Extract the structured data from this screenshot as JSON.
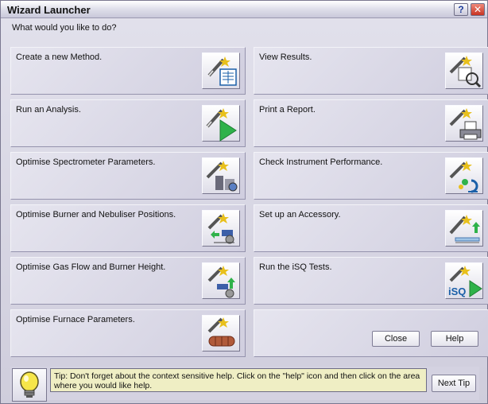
{
  "window": {
    "title": "Wizard Launcher",
    "help_glyph": "?",
    "close_glyph": "✕"
  },
  "prompt": "What would you like to do?",
  "left_cards": [
    {
      "label": "Create a new Method.",
      "icon": "method-wizard-icon"
    },
    {
      "label": "Run an Analysis.",
      "icon": "run-analysis-icon"
    },
    {
      "label": "Optimise Spectrometer Parameters.",
      "icon": "spectrometer-icon"
    },
    {
      "label": "Optimise Burner and Nebuliser Positions.",
      "icon": "burner-position-icon"
    },
    {
      "label": "Optimise Gas Flow and Burner Height.",
      "icon": "gas-flow-icon"
    },
    {
      "label": "Optimise Furnace Parameters.",
      "icon": "furnace-icon"
    }
  ],
  "right_cards": [
    {
      "label": "View Results.",
      "icon": "view-results-icon"
    },
    {
      "label": "Print a Report.",
      "icon": "print-report-icon"
    },
    {
      "label": "Check Instrument Performance.",
      "icon": "instrument-performance-icon"
    },
    {
      "label": "Set up an Accessory.",
      "icon": "accessory-icon"
    },
    {
      "label": "Run the iSQ Tests.",
      "icon": "isq-tests-icon",
      "icon_text": "iSQ"
    }
  ],
  "buttons": {
    "close": "Close",
    "help": "Help",
    "next_tip": "Next Tip"
  },
  "tip": {
    "text": "Tip: Don't forget about the context sensitive help. Click on the \"help\" icon and then click on the area where you would like help.",
    "icon": "lightbulb-icon"
  },
  "colors": {
    "window_bg": "#d8d6e3",
    "tip_bg": "#efeec4",
    "play_green": "#2fb24a",
    "close_red": "#c73322"
  }
}
